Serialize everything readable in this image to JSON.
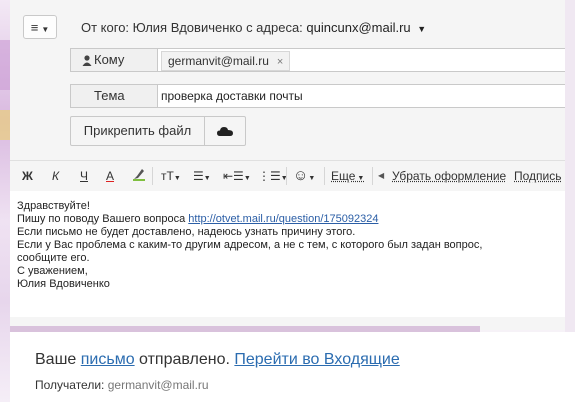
{
  "header": {
    "menu_icon": "hamburger-icon",
    "from_text": "От кого: Юлия Вдовиченко  с адреса:",
    "from_email": "quincunx@mail.ru"
  },
  "to": {
    "label": "Кому",
    "recipient": "germanvit@mail.ru",
    "remove": "×"
  },
  "subject": {
    "label": "Тема",
    "value": "проверка доставки почты"
  },
  "attach": {
    "label": "Прикрепить файл",
    "cloud_icon": "cloud-icon"
  },
  "toolbar": {
    "bold": "Ж",
    "italic": "К",
    "underline": "Ч",
    "text_color": "А",
    "size": "тТ",
    "more": "Еще",
    "clear_format": "Убрать оформление",
    "signature": "Подпись"
  },
  "body": {
    "line1": "Здравствуйте!",
    "line2_prefix": "Пишу по поводу Вашего вопроса ",
    "line2_link": "http://otvet.mail.ru/question/175092324",
    "line3": "Если письмо не будет доставлено, надеюсь узнать причину этого.",
    "line4": "Если у Вас проблема с каким-то другим адресом, а не с тем, с которого был задан вопрос,",
    "line5": "сообщите его.",
    "line6": "С уважением,",
    "line7": "Юлия Вдовиченко"
  },
  "notice": {
    "prefix": "Ваше ",
    "link1": "письмо",
    "middle": " отправлено. ",
    "link2": "Перейти во Входящие",
    "recipients_label": "Получатели: ",
    "recipients_value": "germanvit@mail.ru"
  },
  "colors": {
    "link": "#2b6cb0",
    "background_accent": "#d9b9e0"
  }
}
